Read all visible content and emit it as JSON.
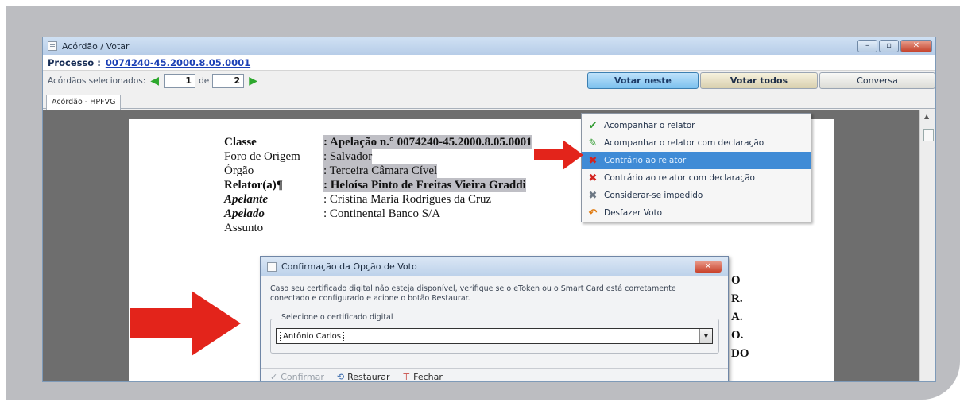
{
  "window": {
    "title": "Acórdão / Votar",
    "controls": [
      "–",
      "▫",
      "✕"
    ]
  },
  "processo": {
    "label": "Processo :",
    "number": "0074240-45.2000.8.05.0001"
  },
  "nav": {
    "label": "Acórdãos selecionados:",
    "current": "1",
    "separator": "de",
    "total": "2"
  },
  "buttons": {
    "votar_neste": "Votar neste",
    "votar_todos": "Votar todos",
    "conversa": "Conversa"
  },
  "tabs": [
    "Acórdão - HPFVG"
  ],
  "document": {
    "fields": [
      {
        "label": "Classe",
        "value": ": Apelação n.° 0074240-45.2000.8.05.0001"
      },
      {
        "label": "Foro de Origem",
        "value": ": Salvador"
      },
      {
        "label": "Órgão",
        "value": ": Terceira Câmara Cível"
      },
      {
        "label": "Relator(a)¶",
        "value": ": Heloísa Pinto de Freitas Vieira Graddi"
      },
      {
        "label": "Apelante",
        "value": ": Cristina Maria Rodrigues da Cruz"
      },
      {
        "label": "Apelado",
        "value": ": Continental Banco S/A"
      },
      {
        "label": "Assunto",
        "value": ""
      }
    ],
    "tail_letters": [
      "O",
      "R.",
      "A.",
      "O.",
      "DO"
    ]
  },
  "vote_menu": {
    "items": [
      {
        "label": "Acompanhar o relator",
        "icon": "check-icon",
        "color": "#2e9a2e"
      },
      {
        "label": "Acompanhar o relator com declaração",
        "icon": "check-doc-icon",
        "color": "#2e9a2e"
      },
      {
        "label": "Contrário ao relator",
        "icon": "x-icon",
        "color": "#d3231f",
        "selected": true
      },
      {
        "label": "Contrário ao relator com declaração",
        "icon": "x-doc-icon",
        "color": "#d3231f"
      },
      {
        "label": "Considerar-se impedido",
        "icon": "impeded-icon",
        "color": "#6c7784"
      },
      {
        "label": "Desfazer Voto",
        "icon": "undo-icon",
        "color": "#e07b12"
      }
    ]
  },
  "dialog": {
    "title": "Confirmação da Opção de Voto",
    "message": "Caso seu certificado digital não esteja disponível, verifique se o eToken ou o Smart Card está corretamente conectado e configurado e acione o botão Restaurar.",
    "group_label": "Selecione o certificado digital",
    "selected_certificate": "Antônio Carlos",
    "actions": {
      "confirmar": "Confirmar",
      "restaurar": "Restaurar",
      "fechar": "Fechar"
    }
  },
  "colors": {
    "accent_arrow": "#e3241b",
    "frame": "#bcbdc1",
    "menu_selected": "#3f8bd6"
  }
}
